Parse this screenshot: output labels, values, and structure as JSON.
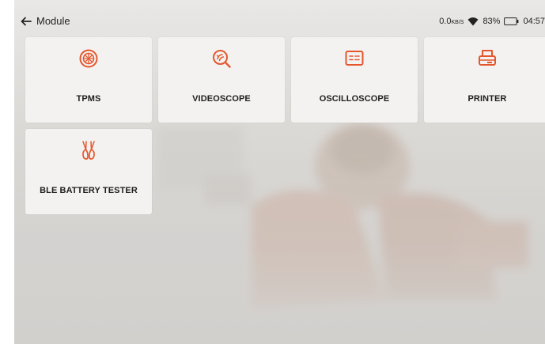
{
  "header": {
    "title": "Module"
  },
  "status": {
    "speed": "0.0",
    "speed_unit": "KB/S",
    "battery": "83%",
    "time": "04:57"
  },
  "modules": [
    {
      "label": "TPMS",
      "icon": "tire-icon"
    },
    {
      "label": "VIDEOSCOPE",
      "icon": "videoscope-icon"
    },
    {
      "label": "OSCILLOSCOPE",
      "icon": "oscilloscope-icon"
    },
    {
      "label": "PRINTER",
      "icon": "printer-icon"
    },
    {
      "label": "BLE BATTERY TESTER",
      "icon": "battery-clamp-icon"
    }
  ],
  "colors": {
    "accent": "#e4572e",
    "tile": "#f4f2f0",
    "background": "#dcdad7"
  }
}
